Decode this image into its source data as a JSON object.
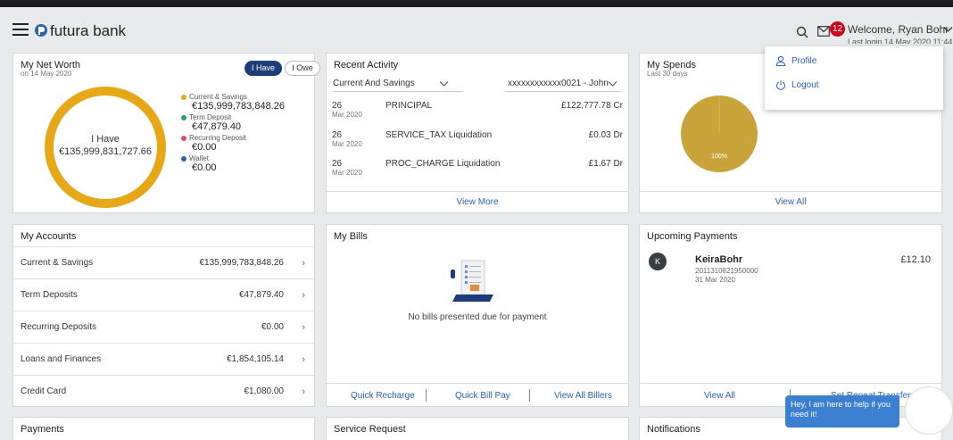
{
  "header": {
    "brand": "futura bank",
    "notification_count": "12",
    "welcome": "Welcome, Ryan Bohr",
    "welcome_sub": "Last login 14 May 2020 11:44"
  },
  "user_menu": {
    "items": [
      {
        "label": "Profile",
        "icon": "user-icon"
      },
      {
        "label": "Logout",
        "icon": "power-icon"
      }
    ]
  },
  "net_worth": {
    "title": "My Net Worth",
    "date": "on 14 May 2020",
    "toggle_have": "I Have",
    "toggle_owe": "I Owe",
    "center_label": "I Have",
    "center_value": "€135,999,831,727.66",
    "legend": [
      {
        "label": "Current & Savings",
        "value": "€135,999,783,848.26",
        "color": "#e6a817"
      },
      {
        "label": "Term Deposit",
        "value": "€47,879.40",
        "color": "#2e9e6b"
      },
      {
        "label": "Recurring Deposit",
        "value": "€0.00",
        "color": "#e0457a"
      },
      {
        "label": "Wallet",
        "value": "€0.00",
        "color": "#2b63b5"
      }
    ]
  },
  "recent_activity": {
    "title": "Recent Activity",
    "filter": "Current And Savings",
    "account": "xxxxxxxxxxxx0021 - John",
    "rows": [
      {
        "day": "26",
        "month": "Mar 2020",
        "desc": "PRINCIPAL",
        "amount": "£122,777.78 Cr"
      },
      {
        "day": "26",
        "month": "Mar 2020",
        "desc": "SERVICE_TAX Liquidation",
        "amount": "£0.03 Dr"
      },
      {
        "day": "26",
        "month": "Mar 2020",
        "desc": "PROC_CHARGE Liquidation",
        "amount": "£1.67 Dr"
      }
    ],
    "footer": "View More"
  },
  "my_spends": {
    "title": "My Spends",
    "subtitle": "Last 30 days",
    "slice_label": "100%",
    "footer": "View All"
  },
  "my_accounts": {
    "title": "My Accounts",
    "rows": [
      {
        "name": "Current & Savings",
        "value": "€135,999,783,848.26"
      },
      {
        "name": "Term Deposits",
        "value": "€47,879.40"
      },
      {
        "name": "Recurring Deposits",
        "value": "€0.00"
      },
      {
        "name": "Loans and Finances",
        "value": "€1,854,105.14"
      },
      {
        "name": "Credit Card",
        "value": "€1,080.00"
      }
    ]
  },
  "my_bills": {
    "title": "My Bills",
    "empty_message": "No bills presented due for payment",
    "links": [
      "Quick Recharge",
      "Quick Bill Pay",
      "View All Billers"
    ]
  },
  "upcoming_payments": {
    "title": "Upcoming Payments",
    "avatar": "K",
    "payee": "KeiraBohr",
    "account": "2011310821950000",
    "date": "31 Mar 2020",
    "amount": "£12.10",
    "links": [
      "View All",
      "Set Repeat Transfers"
    ]
  },
  "bottom_cards": {
    "payments": "Payments",
    "service_request": "Service Request",
    "notifications": "Notifications"
  },
  "chat": {
    "message": "Hey, I am here to help if you need it!"
  },
  "colors": {
    "primary": "#1c3d7a",
    "link": "#2b63b5",
    "donut": "#e6a817",
    "badge": "#d0021b"
  }
}
